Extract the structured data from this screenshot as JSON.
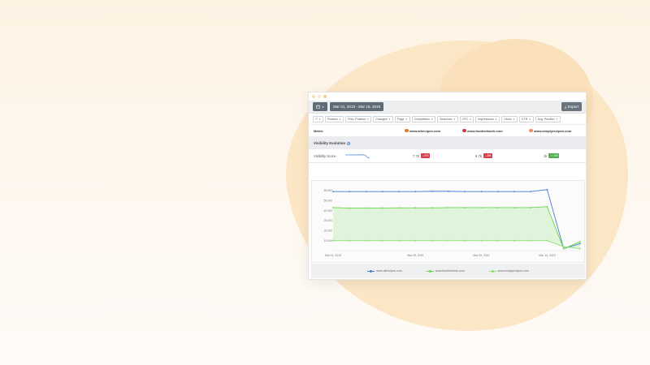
{
  "toolbar": {
    "date_range": "Mar 01, 2019 - Mar 15, 2019",
    "export_label": "Export",
    "calendar_icon": "calendar-icon"
  },
  "filters": [
    "Position",
    "Prev. Position",
    "Changes",
    "Page",
    "Competition",
    "Searches",
    "CPC",
    "Impressions",
    "Clicks",
    "CTR",
    "Avg. Position"
  ],
  "metric_header": {
    "label": "Metric",
    "sites": [
      "www.allrecipes.com",
      "www.foodnetwork.com",
      "www.simplyrecipes.com"
    ]
  },
  "section": {
    "title": "Visibility Evolution"
  },
  "visibility": {
    "label": "Visibility Score",
    "values": [
      "7.7k",
      "6.7k",
      "1k"
    ],
    "changes": [
      "-57K",
      "-58K",
      "+ 40K"
    ]
  },
  "colors": {
    "allrecipes": "#4a7bd0",
    "foodnetwork": "#6ad64c",
    "simplyrecipes": "#8ee06a",
    "down_badge": "#d63b4a",
    "up_badge": "#4caf50"
  },
  "chart_data": {
    "type": "line",
    "x": [
      "Mar 01, 2019",
      "",
      "",
      "",
      "",
      "Mar 05, 2019",
      "",
      "",
      "",
      "Mar 09, 2019",
      "",
      "",
      "",
      "Mar 13, 2019",
      "",
      ""
    ],
    "xticks": [
      "Mar 01, 2019",
      "Mar 05, 2019",
      "Mar 09, 2019",
      "Mar 13, 2019"
    ],
    "yticks": [
      "60,000",
      "50,000",
      "40,000",
      "30,000",
      "20,000",
      "10,000"
    ],
    "ylim": [
      0,
      60000
    ],
    "series": [
      {
        "name": "www.allrecipes.com",
        "values": [
          59000,
          59000,
          59000,
          59000,
          59000,
          59000,
          59300,
          59300,
          59000,
          59000,
          59000,
          59000,
          59000,
          61000,
          2000,
          7000
        ]
      },
      {
        "name": "www.foodnetwork.com",
        "values": [
          43000,
          42500,
          42600,
          42600,
          42700,
          42700,
          42700,
          43000,
          43000,
          43000,
          43000,
          43000,
          43000,
          44000,
          2000,
          9000
        ]
      },
      {
        "name": "www.simplyrecipes.com",
        "values": [
          10000,
          10000,
          10000,
          10000,
          10000,
          10000,
          10000,
          10000,
          10000,
          10000,
          10000,
          10000,
          10000,
          10000,
          4000,
          2000
        ]
      }
    ]
  }
}
